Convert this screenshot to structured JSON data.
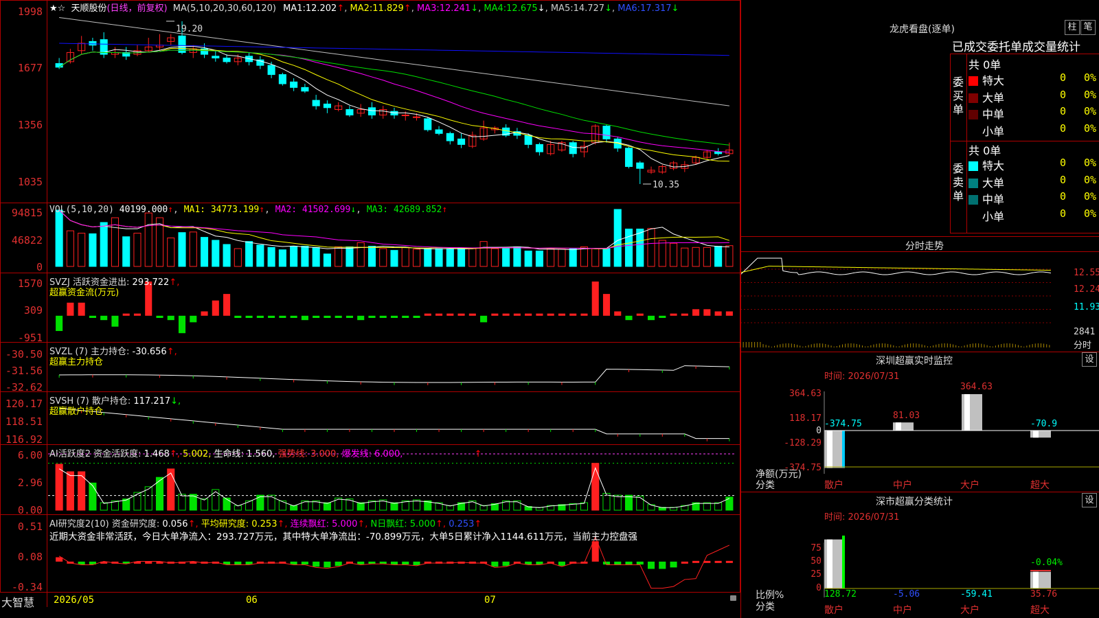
{
  "colors": {
    "up": "#ff2020",
    "down": "#00ffff",
    "ma1": "#ffffff",
    "ma2": "#ffff00",
    "ma3": "#ff00ff",
    "ma4": "#00e000",
    "ma5": "#c0c0c0",
    "ma6": "#1010ff",
    "grid": "#b00000",
    "green": "#00e000",
    "yellow": "#ffff00",
    "magenta": "#ff40ff"
  },
  "main": {
    "star_icon": "★",
    "star_icon2": "☆",
    "stock": "天顺股份",
    "period": "(日线，前复权)",
    "ma_label": "MA(5,10,20,30,60,120)",
    "ma": [
      {
        "k": "MA1:",
        "v": "12.202",
        "a": "↑"
      },
      {
        "k": "MA2:",
        "v": "11.829",
        "a": "↑"
      },
      {
        "k": "MA3:",
        "v": "12.241",
        "a": "↓"
      },
      {
        "k": "MA4:",
        "v": "12.675",
        "a": "↓"
      },
      {
        "k": "MA5:",
        "v": "14.727",
        "a": "↓"
      },
      {
        "k": "MA6:",
        "v": "17.317",
        "a": "↓"
      }
    ],
    "y_ticks": [
      "1998",
      "1677",
      "1356",
      "1035"
    ],
    "high_label": "19.20",
    "low_label": "10.35"
  },
  "vol": {
    "label": "VOL(5,10,20)",
    "value": "40199.000",
    "arrow": "↑",
    "ma1": "MA1: 34773.199",
    "ma1a": "↑",
    "ma2": "MA2: 41502.699",
    "ma2a": "↓",
    "ma3": "MA3: 42689.852",
    "ma3a": "↑",
    "y_ticks": [
      "94815",
      "46822",
      "0"
    ]
  },
  "svzj": {
    "label": "SVZJ  活跃资金进出:",
    "value": "293.722",
    "arrow": "↑,",
    "sub": "超赢资金流(万元)",
    "y_ticks": [
      "1570",
      "309",
      "-951"
    ]
  },
  "svzl": {
    "label": "SVZL (7) 主力持仓:",
    "value": "-30.656",
    "arrow": "↑,",
    "sub": "超赢主力持仓",
    "y_ticks": [
      "-30.50",
      "-31.56",
      "-32.62"
    ]
  },
  "svsh": {
    "label": "SVSH (7) 散户持仓:",
    "value": "117.217",
    "arrow": "↓,",
    "sub": "超赢散户持仓",
    "y_ticks": [
      "120.17",
      "118.51",
      "116.92"
    ]
  },
  "ai1": {
    "label": "AI活跃度2 资金活跃度:",
    "v1": "1.468",
    "v1a": "↑,",
    "v2": "5.002,",
    "v3": "生命线: 1.560,",
    "v4": "强势线: 3.000,",
    "v5": "爆发线: 6.000,",
    "v6": "↑",
    "y_ticks": [
      "6.00",
      "2.96",
      "0.00"
    ]
  },
  "ai2": {
    "label": "AI研究度2(10) 资金研究度:",
    "v1": "0.056",
    "v1a": "↑,",
    "v2": "平均研究度: 0.253",
    "v2a": "↑,",
    "v3": "连续飘红: 5.000",
    "v3a": "↑,",
    "v4": "N日飘红: 5.000",
    "v4a": "↑,",
    "v5": "0.253",
    "v5a": "↑",
    "note": "近期大资金非常活跃，今日大单净流入：293.727万元，其中特大单净流出：-70.899万元，大单5日累计净入1144.611万元，当前主力控盘强",
    "y_ticks": [
      "0.51",
      "0.08",
      "-0.34"
    ]
  },
  "xaxis": {
    "brand": "大智慧",
    "labels": [
      "2026/05",
      "06",
      "07"
    ]
  },
  "right": {
    "lhb_title": "龙虎看盘(逐单)",
    "btn_bar": "柱",
    "btn_pen": "笔",
    "tabs": "已成交委托单成交量统计",
    "buy": {
      "side": "委买单",
      "total": "共 0单",
      "rows": [
        {
          "name": "特大",
          "n": "0",
          "p": "0%",
          "c": "#ff0000"
        },
        {
          "name": "大单",
          "n": "0",
          "p": "0%",
          "c": "#800000"
        },
        {
          "name": "中单",
          "n": "0",
          "p": "0%",
          "c": "#600000"
        },
        {
          "name": "小单",
          "n": "0",
          "p": "0%",
          "c": ""
        }
      ]
    },
    "sell": {
      "side": "委卖单",
      "total": "共 0单",
      "rows": [
        {
          "name": "特大",
          "n": "0",
          "p": "0%",
          "c": "#00ffff"
        },
        {
          "name": "大单",
          "n": "0",
          "p": "0%",
          "c": "#008080"
        },
        {
          "name": "中单",
          "n": "0",
          "p": "0%",
          "c": "#007070"
        },
        {
          "name": "小单",
          "n": "0",
          "p": "0%",
          "c": ""
        }
      ]
    },
    "fenshi_title": "分时走势",
    "fenshi_y": [
      "12.55",
      "12.24",
      "11.93",
      "2841"
    ],
    "fenshi_unit": "分时",
    "sz_title": "深圳超赢实时监控",
    "sz_btn": "设",
    "sz_time": "时间: 2026/07/31",
    "sz_y": [
      "364.63",
      "118.17",
      "0",
      "-128.29",
      "-374.75"
    ],
    "sz_vals": [
      {
        "cat": "散户",
        "val": "-374.75"
      },
      {
        "cat": "中户",
        "val": "81.03"
      },
      {
        "cat": "大户",
        "val": "364.63"
      },
      {
        "cat": "超大",
        "val": "-70.9"
      }
    ],
    "sz_unit1": "净额(万元)",
    "sz_unit2": "分类",
    "ss_title": "深市超赢分类统计",
    "ss_btn": "设",
    "ss_time": "时间: 2026/07/31",
    "ss_y": [
      "75",
      "50",
      "25",
      "0"
    ],
    "ss_vals": [
      {
        "cat": "散户",
        "val": "128.72"
      },
      {
        "cat": "中户",
        "val": "-5.06"
      },
      {
        "cat": "大户",
        "val": "-59.41"
      },
      {
        "cat": "超大",
        "val": "35.76"
      }
    ],
    "ss_extra": "-0.04%",
    "ss_unit1": "比例%",
    "ss_unit2": "分类"
  },
  "chart_data": {
    "type": "candlestick",
    "candles": [
      [
        16.9,
        16.7,
        17.2,
        16.6
      ],
      [
        17.0,
        17.5,
        17.7,
        16.9
      ],
      [
        17.6,
        18.0,
        18.4,
        17.4
      ],
      [
        18.1,
        17.9,
        18.3,
        17.6
      ],
      [
        18.2,
        17.4,
        18.6,
        17.2
      ],
      [
        17.4,
        17.5,
        17.8,
        17.2
      ],
      [
        17.5,
        17.3,
        17.8,
        17.1
      ],
      [
        17.4,
        17.6,
        17.9,
        17.3
      ],
      [
        17.6,
        17.8,
        18.3,
        17.5
      ],
      [
        17.8,
        17.9,
        18.5,
        17.6
      ],
      [
        18.1,
        18.3,
        18.5,
        17.9
      ],
      [
        18.4,
        17.5,
        19.2,
        17.4
      ],
      [
        17.5,
        17.7,
        17.9,
        17.2
      ],
      [
        17.7,
        17.4,
        18.0,
        17.2
      ],
      [
        17.3,
        17.2,
        17.6,
        17.0
      ],
      [
        17.2,
        17.0,
        17.4,
        16.9
      ],
      [
        17.0,
        17.2,
        17.4,
        16.8
      ],
      [
        17.3,
        17.0,
        17.5,
        16.8
      ],
      [
        17.1,
        16.8,
        17.3,
        16.6
      ],
      [
        16.8,
        16.3,
        17.0,
        16.1
      ],
      [
        16.3,
        15.8,
        16.4,
        15.7
      ],
      [
        15.9,
        15.6,
        16.1,
        15.4
      ],
      [
        15.6,
        15.4,
        15.8,
        15.3
      ],
      [
        14.9,
        14.6,
        15.2,
        14.4
      ],
      [
        14.7,
        14.5,
        14.9,
        14.2
      ],
      [
        14.4,
        14.6,
        14.8,
        14.3
      ],
      [
        14.4,
        14.1,
        14.6,
        14.0
      ],
      [
        14.2,
        14.4,
        14.7,
        14.0
      ],
      [
        14.5,
        14.1,
        14.8,
        13.9
      ],
      [
        14.1,
        14.4,
        14.6,
        13.9
      ],
      [
        14.3,
        14.1,
        14.5,
        13.9
      ],
      [
        14.1,
        14.1,
        14.3,
        13.8
      ],
      [
        14.0,
        14.0,
        14.2,
        13.8
      ],
      [
        13.9,
        13.3,
        14.0,
        13.2
      ],
      [
        13.3,
        13.1,
        13.5,
        13.0
      ],
      [
        13.1,
        12.7,
        13.2,
        12.5
      ],
      [
        12.8,
        12.5,
        13.1,
        12.3
      ],
      [
        12.4,
        13.0,
        13.2,
        12.3
      ],
      [
        12.8,
        13.4,
        13.8,
        12.7
      ],
      [
        13.3,
        13.4,
        13.5,
        13.1
      ],
      [
        13.4,
        13.0,
        13.6,
        12.9
      ],
      [
        13.2,
        13.0,
        13.4,
        12.8
      ],
      [
        13.0,
        12.5,
        13.1,
        12.3
      ],
      [
        12.5,
        12.1,
        12.6,
        11.9
      ],
      [
        12.0,
        12.5,
        12.7,
        11.9
      ],
      [
        12.2,
        12.6,
        12.7,
        12.1
      ],
      [
        12.6,
        12.0,
        12.7,
        11.8
      ],
      [
        12.1,
        12.4,
        12.7,
        11.8
      ],
      [
        12.6,
        13.5,
        13.6,
        12.5
      ],
      [
        13.5,
        12.8,
        13.6,
        12.6
      ],
      [
        12.8,
        12.3,
        12.9,
        12.1
      ],
      [
        12.3,
        11.3,
        12.4,
        11.2
      ],
      [
        11.5,
        11.2,
        11.6,
        10.35
      ],
      [
        11.0,
        11.1,
        11.3,
        10.9
      ],
      [
        11.0,
        11.3,
        11.4,
        10.9
      ],
      [
        11.2,
        11.5,
        11.6,
        11.1
      ],
      [
        11.2,
        11.4,
        11.6,
        11.0
      ],
      [
        11.5,
        11.8,
        11.9,
        11.4
      ],
      [
        11.8,
        12.1,
        12.2,
        11.7
      ],
      [
        12.1,
        12.0,
        12.3,
        11.9
      ],
      [
        12.0,
        12.2,
        12.6,
        11.9
      ]
    ],
    "volumes": [
      94815,
      60000,
      56000,
      55000,
      74000,
      82000,
      50000,
      56000,
      90000,
      82000,
      48000,
      57000,
      58000,
      49000,
      44000,
      37000,
      30000,
      42000,
      36000,
      32000,
      28000,
      34000,
      34000,
      32000,
      21000,
      33000,
      33000,
      40000,
      34000,
      30000,
      27000,
      32000,
      29000,
      30000,
      30000,
      29000,
      30000,
      30000,
      42000,
      30000,
      30000,
      33000,
      26000,
      26000,
      30000,
      29000,
      30000,
      33000,
      30000,
      30000,
      96000,
      63000,
      63000,
      64000,
      44000,
      39000,
      31000,
      32000,
      32000,
      34000,
      35000
    ],
    "svzj": [
      -700,
      600,
      600,
      -100,
      -200,
      -500,
      100,
      100,
      1570,
      -100,
      -200,
      -800,
      -300,
      200,
      700,
      1000,
      -100,
      -100,
      -100,
      -100,
      -100,
      -100,
      -200,
      -100,
      -100,
      -100,
      -100,
      -200,
      -100,
      -100,
      -100,
      -100,
      -100,
      100,
      100,
      100,
      100,
      100,
      -300,
      100,
      100,
      100,
      100,
      100,
      100,
      100,
      100,
      100,
      1570,
      1000,
      200,
      -200,
      100,
      -200,
      -100,
      100,
      100,
      300,
      300,
      200,
      200
    ],
    "ai1": [
      4.9,
      4.1,
      4.1,
      2.9,
      0.8,
      1.0,
      1.2,
      1.9,
      2.5,
      3.5,
      4.4,
      1.7,
      1.7,
      1.2,
      2.2,
      1.3,
      0.5,
      1.0,
      1.6,
      1.6,
      1.0,
      0.5,
      1.0,
      1.0,
      0.8,
      1.3,
      1.2,
      0.8,
      1.0,
      1.1,
      0.8,
      1.0,
      1.1,
      1.0,
      0.8,
      0.5,
      0.8,
      1.0,
      0.5,
      0.7,
      1.0,
      1.0,
      0.4,
      0.3,
      0.5,
      0.6,
      0.7,
      0.8,
      5.0,
      1.8,
      1.6,
      1.6,
      1.5,
      0.6,
      0.3,
      0.3,
      0.5,
      0.8,
      0.8,
      0.8,
      1.4
    ],
    "ai2": [
      0.08,
      0.0,
      -0.02,
      -0.02,
      0.02,
      0.0,
      -0.01,
      0.02,
      0.02,
      0.02,
      0.0,
      0.01,
      0.02,
      0.0,
      0.01,
      -0.02,
      -0.02,
      -0.02,
      0.0,
      0.0,
      0.0,
      -0.02,
      -0.02,
      -0.05,
      -0.06,
      -0.04,
      0.0,
      -0.02,
      -0.01,
      -0.01,
      -0.02,
      -0.02,
      -0.03,
      0.0,
      0.0,
      0.0,
      0.01,
      0.0,
      0.0,
      -0.05,
      -0.04,
      0.0,
      -0.02,
      -0.02,
      0.0,
      -0.04,
      0.0,
      0.0,
      0.3,
      -0.02,
      -0.02,
      -0.02,
      -0.02,
      -0.08,
      -0.08,
      -0.06,
      0.02,
      0.03,
      0.03,
      0.03,
      0.03
    ]
  }
}
